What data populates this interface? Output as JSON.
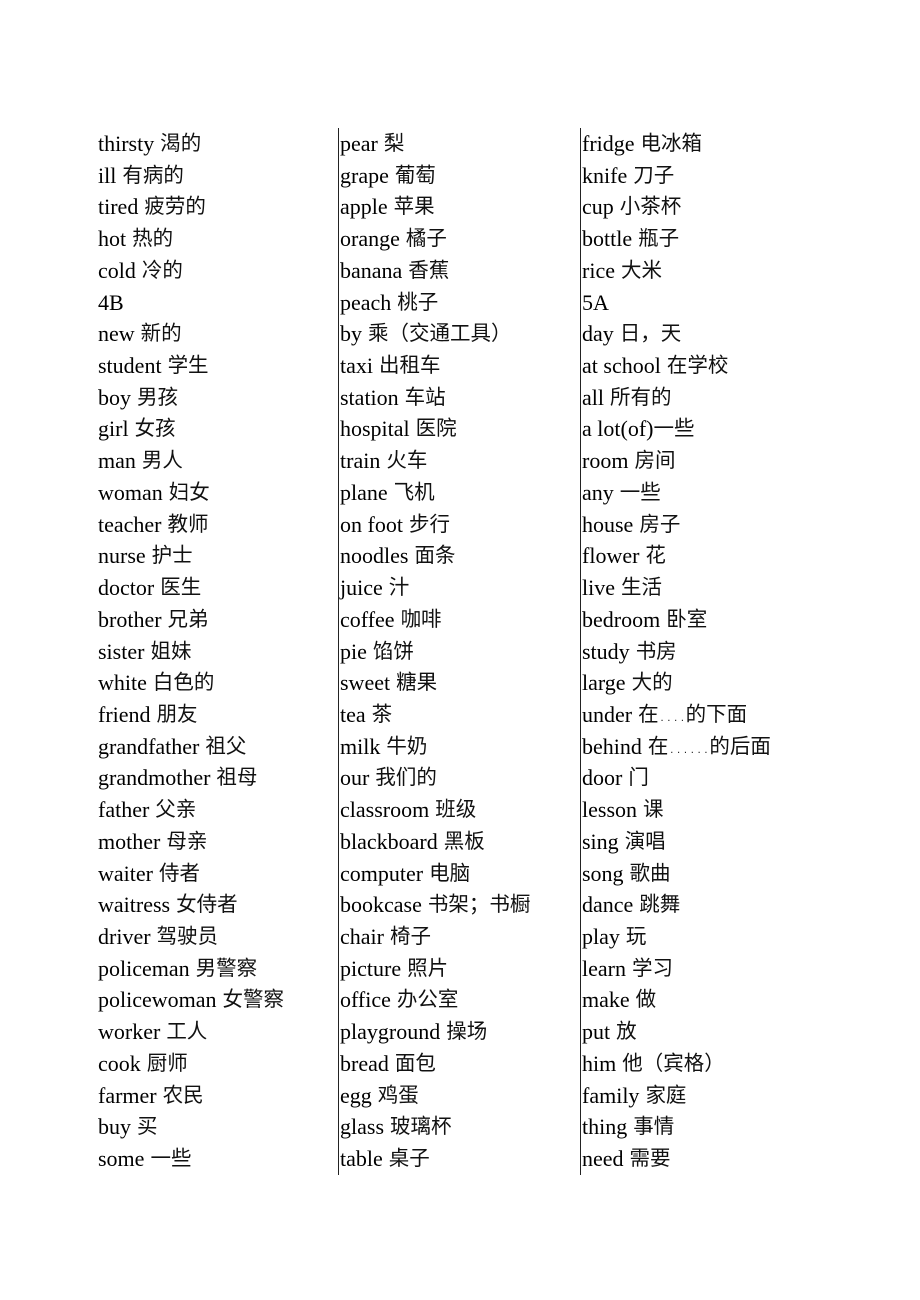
{
  "columns": [
    {
      "entries": [
        {
          "en": "thirsty",
          "zh": "渴的"
        },
        {
          "en": "ill",
          "zh": "有病的"
        },
        {
          "en": "tired",
          "zh": "疲劳的"
        },
        {
          "en": "hot",
          "zh": "热的"
        },
        {
          "en": "cold",
          "zh": "冷的"
        },
        {
          "en": "4B",
          "zh": ""
        },
        {
          "en": "new",
          "zh": "新的"
        },
        {
          "en": "student",
          "zh": "学生"
        },
        {
          "en": "boy",
          "zh": "男孩"
        },
        {
          "en": "girl",
          "zh": "女孩"
        },
        {
          "en": "man",
          "zh": "男人"
        },
        {
          "en": "woman",
          "zh": "妇女"
        },
        {
          "en": "teacher",
          "zh": "教师"
        },
        {
          "en": "nurse",
          "zh": "护士"
        },
        {
          "en": "doctor",
          "zh": "医生"
        },
        {
          "en": "brother",
          "zh": "兄弟"
        },
        {
          "en": "sister",
          "zh": "姐妹"
        },
        {
          "en": "white",
          "zh": "白色的"
        },
        {
          "en": "friend",
          "zh": "朋友"
        },
        {
          "en": "grandfather",
          "zh": "祖父"
        },
        {
          "en": "grandmother",
          "zh": "祖母"
        },
        {
          "en": "father",
          "zh": "父亲"
        },
        {
          "en": "mother",
          "zh": "母亲"
        },
        {
          "en": "waiter",
          "zh": "侍者"
        },
        {
          "en": "waitress",
          "zh": "女侍者"
        },
        {
          "en": "driver",
          "zh": "驾驶员"
        },
        {
          "en": "policeman",
          "zh": "男警察"
        },
        {
          "en": "policewoman",
          "zh": "女警察"
        },
        {
          "en": "worker",
          "zh": "工人"
        },
        {
          "en": "cook",
          "zh": "厨师"
        },
        {
          "en": "farmer",
          "zh": "农民"
        },
        {
          "en": "buy",
          "zh": "买"
        },
        {
          "en": "some",
          "zh": "一些"
        }
      ]
    },
    {
      "entries": [
        {
          "en": "pear",
          "zh": "梨"
        },
        {
          "en": "grape",
          "zh": "葡萄"
        },
        {
          "en": "apple",
          "zh": "苹果"
        },
        {
          "en": "orange",
          "zh": "橘子"
        },
        {
          "en": "banana",
          "zh": "香蕉"
        },
        {
          "en": "peach",
          "zh": "桃子"
        },
        {
          "en": "by",
          "zh": "乘（交通工具）"
        },
        {
          "en": "taxi",
          "zh": "出租车"
        },
        {
          "en": "station",
          "zh": "车站"
        },
        {
          "en": "hospital",
          "zh": "医院"
        },
        {
          "en": "train",
          "zh": "火车"
        },
        {
          "en": "plane",
          "zh": "飞机"
        },
        {
          "en": "on foot",
          "zh": "步行"
        },
        {
          "en": "noodles",
          "zh": "面条"
        },
        {
          "en": "juice",
          "zh": "汁"
        },
        {
          "en": "coffee",
          "zh": "咖啡"
        },
        {
          "en": "pie",
          "zh": "馅饼"
        },
        {
          "en": "sweet",
          "zh": "糖果"
        },
        {
          "en": "tea",
          "zh": "茶"
        },
        {
          "en": "milk",
          "zh": "牛奶"
        },
        {
          "en": "our",
          "zh": "我们的"
        },
        {
          "en": "classroom",
          "zh": "班级"
        },
        {
          "en": "blackboard",
          "zh": "黑板"
        },
        {
          "en": "computer",
          "zh": "电脑"
        },
        {
          "en": "bookcase",
          "zh": "书架；书橱"
        },
        {
          "en": "chair",
          "zh": "椅子"
        },
        {
          "en": "picture",
          "zh": "照片"
        },
        {
          "en": "office",
          "zh": "办公室"
        },
        {
          "en": "playground",
          "zh": "操场"
        },
        {
          "en": "bread",
          "zh": "面包"
        },
        {
          "en": "egg",
          "zh": "鸡蛋"
        },
        {
          "en": "glass",
          "zh": "玻璃杯"
        },
        {
          "en": "table",
          "zh": "桌子"
        }
      ]
    },
    {
      "entries": [
        {
          "en": "fridge",
          "zh": "电冰箱"
        },
        {
          "en": "knife",
          "zh": "刀子"
        },
        {
          "en": "cup",
          "zh": "小茶杯"
        },
        {
          "en": "bottle",
          "zh": "瓶子"
        },
        {
          "en": "rice",
          "zh": "大米"
        },
        {
          "en": "5A",
          "zh": ""
        },
        {
          "en": "day",
          "zh": "日，天"
        },
        {
          "en": "at school",
          "zh": "在学校"
        },
        {
          "en": "all",
          "zh": "所有的"
        },
        {
          "en": "a lot(of)",
          "zh": "一些"
        },
        {
          "en": "room",
          "zh": "房间"
        },
        {
          "en": "any",
          "zh": "一些"
        },
        {
          "en": "house",
          "zh": "房子"
        },
        {
          "en": "flower",
          "zh": "花"
        },
        {
          "en": "live",
          "zh": "生活"
        },
        {
          "en": "bedroom",
          "zh": "卧室"
        },
        {
          "en": "study",
          "zh": "书房"
        },
        {
          "en": "large",
          "zh": "大的"
        },
        {
          "en": "under",
          "zh": "在….的下面"
        },
        {
          "en": "behind",
          "zh": "在……的后面"
        },
        {
          "en": "door",
          "zh": "门"
        },
        {
          "en": "lesson",
          "zh": "课"
        },
        {
          "en": "sing",
          "zh": "演唱"
        },
        {
          "en": "song",
          "zh": "歌曲"
        },
        {
          "en": "dance",
          "zh": "跳舞"
        },
        {
          "en": "play",
          "zh": "玩"
        },
        {
          "en": "learn",
          "zh": "学习"
        },
        {
          "en": "make",
          "zh": "做"
        },
        {
          "en": "put",
          "zh": "放"
        },
        {
          "en": "him",
          "zh": "他（宾格）"
        },
        {
          "en": "family",
          "zh": "家庭"
        },
        {
          "en": "thing",
          "zh": "事情"
        },
        {
          "en": "need",
          "zh": "需要"
        }
      ]
    }
  ]
}
